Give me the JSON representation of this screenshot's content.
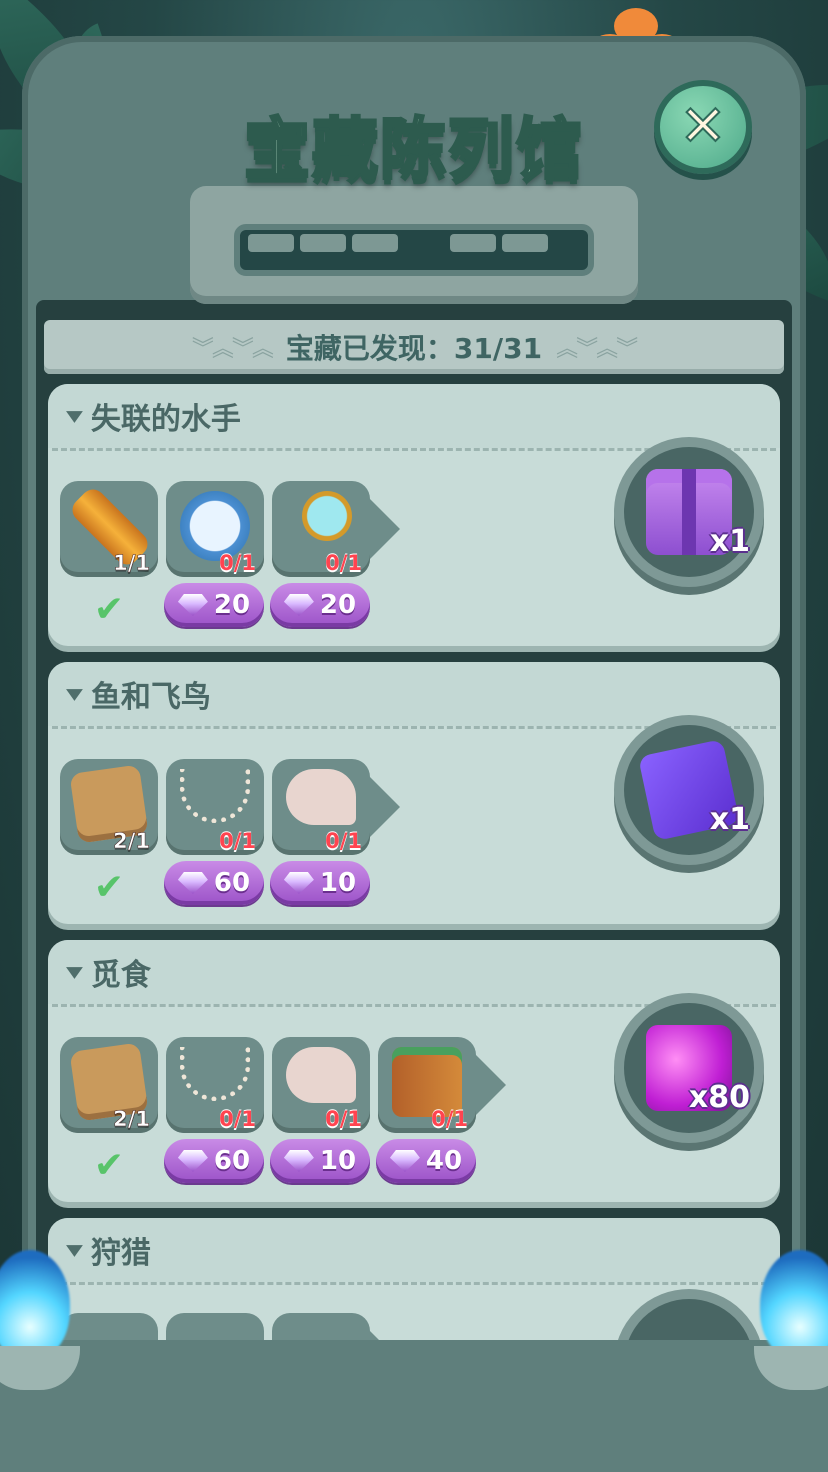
{
  "title": "宝藏陈列馆",
  "progress": {
    "label": "宝藏已发现：",
    "found": "31/31"
  },
  "close_icon": "close-icon",
  "collections": [
    {
      "name": "失联的水手",
      "items": [
        {
          "icon": "telescope-icon",
          "count": "1/1",
          "collected": true
        },
        {
          "icon": "compass-icon",
          "count": "0/1",
          "price": "20"
        },
        {
          "icon": "magnifier-icon",
          "count": "0/1",
          "price": "20"
        }
      ],
      "reward": {
        "icon": "gift-box-icon",
        "qty": "x1"
      }
    },
    {
      "name": "鱼和飞鸟",
      "items": [
        {
          "icon": "fish-fossil-icon",
          "count": "2/1",
          "collected": true
        },
        {
          "icon": "bone-necklace-icon",
          "count": "0/1",
          "price": "60"
        },
        {
          "icon": "bird-skull-icon",
          "count": "0/1",
          "price": "10"
        }
      ],
      "reward": {
        "icon": "card-ticket-icon",
        "qty": "x1"
      }
    },
    {
      "name": "觅食",
      "items": [
        {
          "icon": "fish-fossil-icon",
          "count": "2/1",
          "collected": true
        },
        {
          "icon": "bone-necklace-icon",
          "count": "0/1",
          "price": "60"
        },
        {
          "icon": "bird-skull-icon",
          "count": "0/1",
          "price": "10"
        },
        {
          "icon": "binocular-icon",
          "count": "0/1",
          "price": "40"
        }
      ],
      "reward": {
        "icon": "purple-gems-icon",
        "qty": "x80"
      }
    },
    {
      "name": "狩猎"
    }
  ],
  "colors": {
    "accent": "#9b52c8",
    "check": "#58c46a",
    "missing": "#ff4450"
  }
}
